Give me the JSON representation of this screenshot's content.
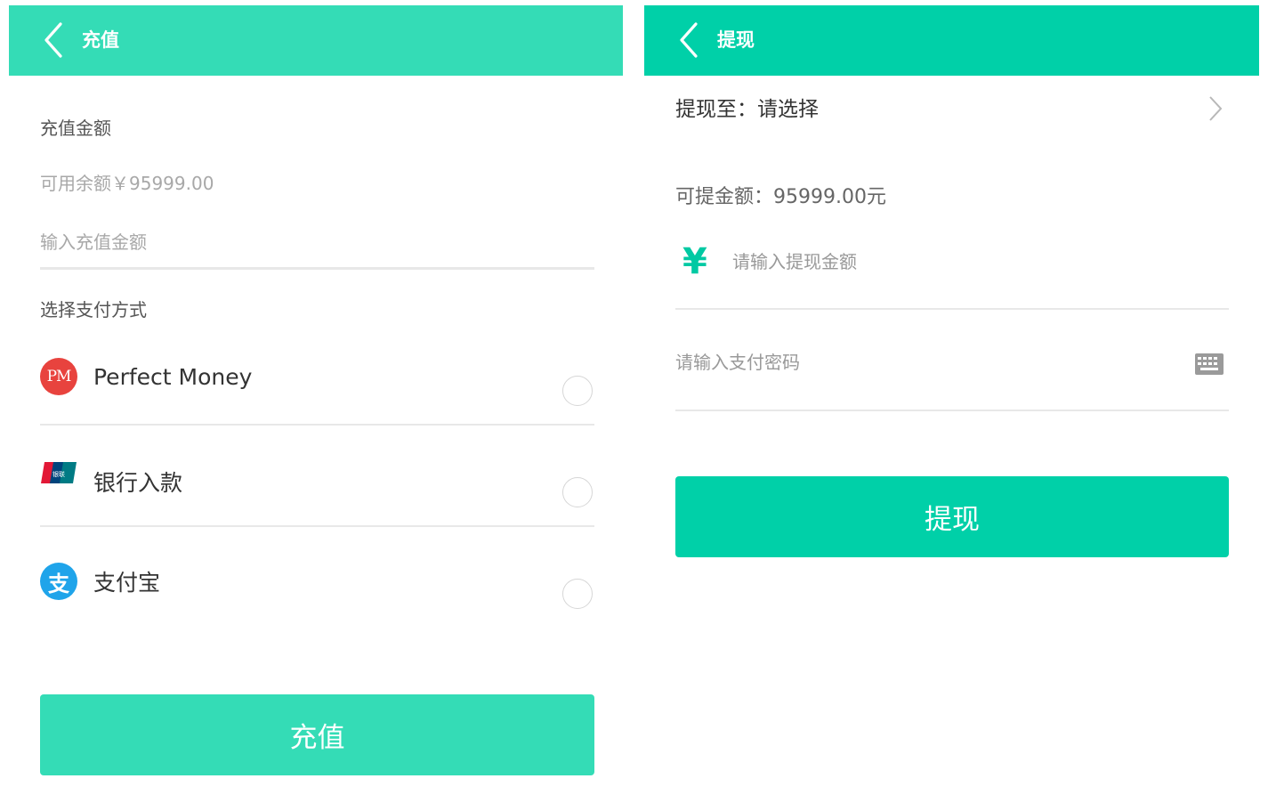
{
  "recharge": {
    "title": "充值",
    "amount_label": "充值金额",
    "balance_text": "可用余额￥95999.00",
    "amount_placeholder": "输入充值金额",
    "method_label": "选择支付方式",
    "methods": [
      {
        "name": "Perfect Money",
        "icon": "perfect-money-icon",
        "icon_text": "PM",
        "selected": false
      },
      {
        "name": "银行入款",
        "icon": "unionpay-icon",
        "icon_text": "UnionPay 银联",
        "selected": false
      },
      {
        "name": "支付宝",
        "icon": "alipay-icon",
        "icon_text": "支",
        "selected": false
      }
    ],
    "submit_label": "充值",
    "accent_color": "#34dcb6"
  },
  "withdraw": {
    "title": "提现",
    "target_text": "提现至：请选择",
    "available_text": "可提金额：95999.00元",
    "currency_symbol": "¥",
    "amount_placeholder": "请输入提现金额",
    "password_placeholder": "请输入支付密码",
    "submit_label": "提现",
    "accent_color": "#00d0a8"
  }
}
